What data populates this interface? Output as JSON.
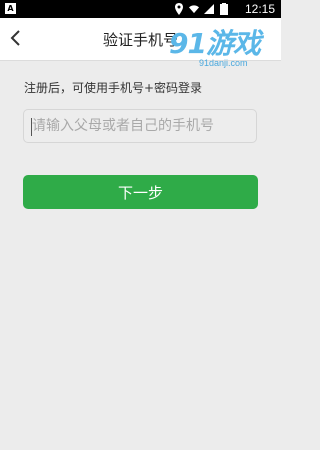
{
  "statusbar": {
    "left_icon": "A",
    "time": "12:15",
    "icons": [
      "location-icon",
      "wifi-icon",
      "signal-icon",
      "battery-icon"
    ]
  },
  "header": {
    "title": "验证手机号",
    "back_icon": "chevron-left-icon"
  },
  "watermark": {
    "logo_text": "91游戏",
    "site": "91danji.com"
  },
  "form": {
    "hint": "注册后，可使用手机号+密码登录",
    "phone_placeholder": "请输入父母或者自己的手机号",
    "phone_value": "",
    "next_label": "下一步"
  },
  "colors": {
    "primary_button": "#2fab48",
    "background": "#ececec",
    "header_bg": "#ffffff"
  }
}
